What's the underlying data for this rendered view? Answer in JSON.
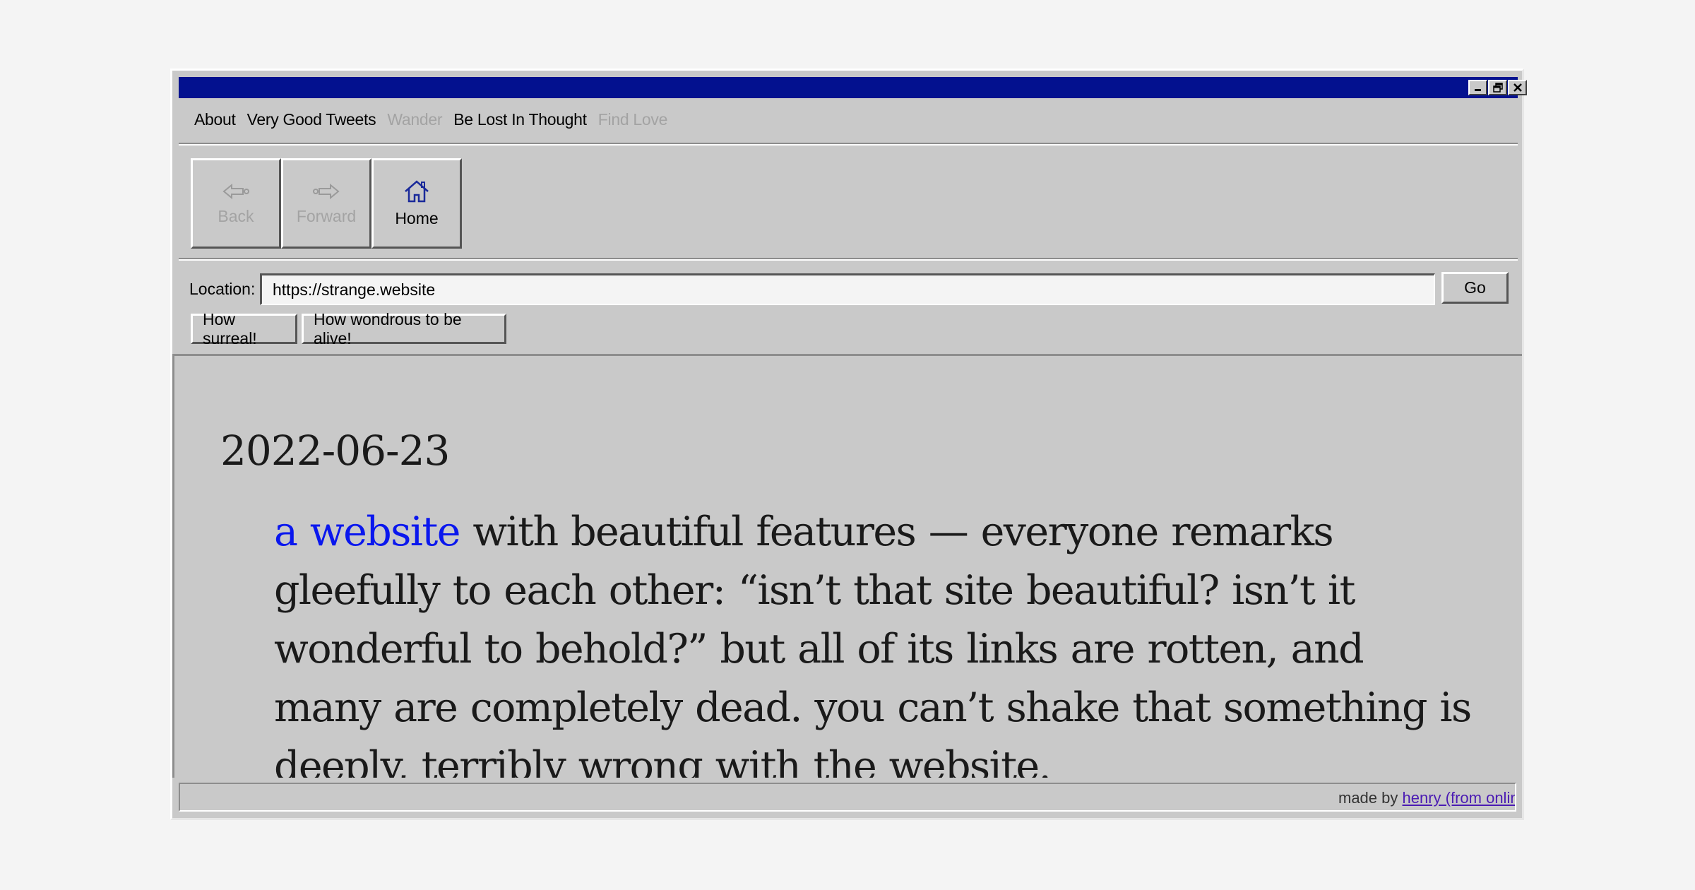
{
  "menu": {
    "items": [
      {
        "label": "About",
        "enabled": true
      },
      {
        "label": "Very Good Tweets",
        "enabled": true
      },
      {
        "label": "Wander",
        "enabled": false
      },
      {
        "label": "Be Lost In Thought",
        "enabled": true
      },
      {
        "label": "Find Love",
        "enabled": false
      }
    ]
  },
  "toolbar": {
    "back_label": "Back",
    "forward_label": "Forward",
    "home_label": "Home",
    "back_icon": "back-arrow-icon",
    "forward_icon": "forward-arrow-icon",
    "home_icon": "house-icon"
  },
  "location": {
    "label": "Location:",
    "value": "https://strange.website",
    "go_label": "Go"
  },
  "quick_buttons": {
    "surreal": "How surreal!",
    "wondrous": "How wondrous to be alive!"
  },
  "content": {
    "date": "2022-06-23",
    "link_text": "a website",
    "body": " with beautiful features — everyone remarks gleefully to each other: “isn’t that site beautiful? isn’t it wonderful to behold?” but all of its links are rotten, and many are completely dead. you can’t shake that something is deeply, terribly wrong with the website."
  },
  "status": {
    "prefix": "made by ",
    "credit_link": "henry (from online)"
  },
  "colors": {
    "titlebar": "#03118f",
    "chrome": "#c9c9c9",
    "link": "#0a17ee",
    "disabled_text": "#a3a3a3"
  }
}
